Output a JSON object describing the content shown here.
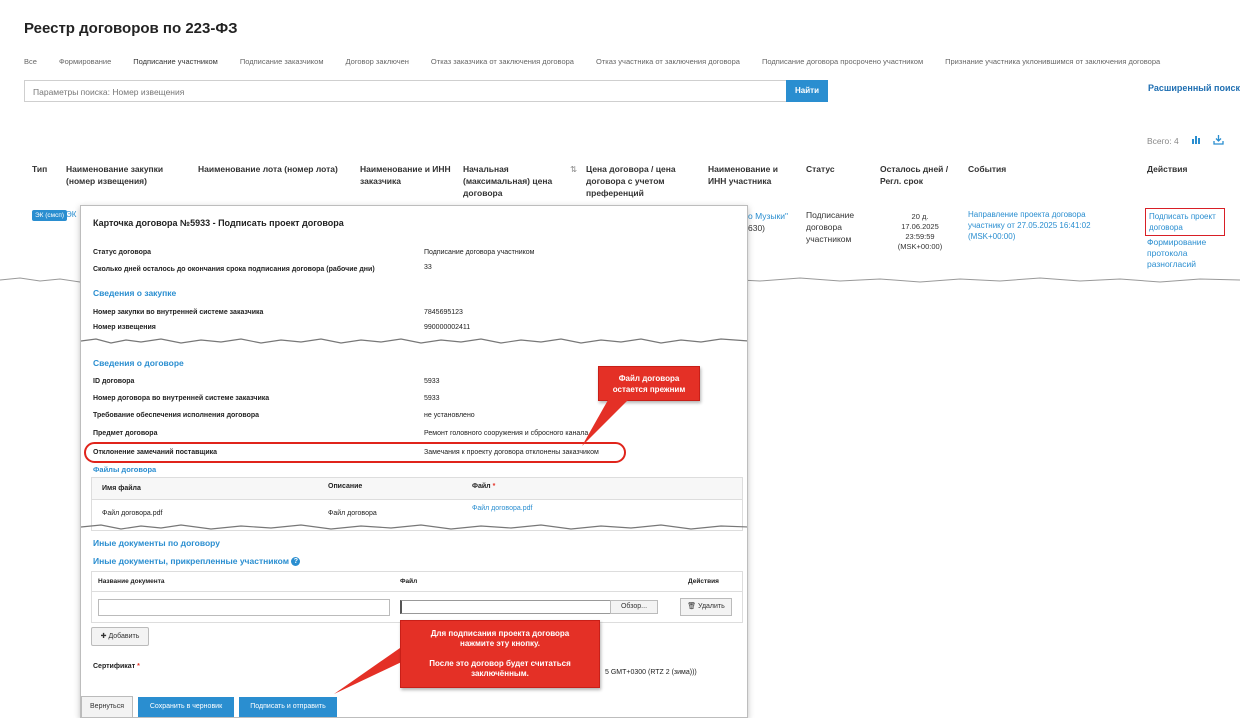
{
  "page": {
    "title": "Реестр договоров по 223-ФЗ"
  },
  "tabs": [
    "Все",
    "Формирование",
    "Подписание участником",
    "Подписание заказчиком",
    "Договор заключен",
    "Отказ заказчика от заключения договора",
    "Отказ участника от заключения договора",
    "Подписание договора просрочено участником",
    "Признание участника уклонившимся от заключения договора"
  ],
  "search": {
    "placeholder": "Параметры поиска: Номер извещения",
    "button": "Найти",
    "advanced": "Расширенный поиск"
  },
  "total": {
    "label": "Всего: 4"
  },
  "columns": {
    "type": "Тип",
    "purchase": "Наименование закупки (номер извещения)",
    "lot": "Наименование лота (номер лота)",
    "customer": "Наименование и ИНН заказчика",
    "start_price": "Начальная (максимальная) цена договора",
    "contract_price": "Цена договора / цена договора с учетом преференций",
    "participant": "Наименование и ИНН участника",
    "status": "Статус",
    "days_left": "Осталось дней / Регл. срок",
    "events": "События",
    "actions": "Действия"
  },
  "row": {
    "type_tag": "ЭК (смсп)",
    "purchase_frag": "ЭК",
    "participant_frag1": "о Музыки\"",
    "participant_frag2": "630)",
    "status_1": "Подписание",
    "status_2": "договора",
    "status_3": "участником",
    "days_1": "20 д.",
    "days_2": "17.06.2025",
    "days_3": "23:59:59",
    "days_4": "(MSK+00:00)",
    "event_1": "Направление проекта договора",
    "event_2": "участнику от 27.05.2025 16:41:02",
    "event_3": "(MSK+00:00)",
    "action_sign_1": "Подписать проект",
    "action_sign_2": "договора",
    "action_proto_1": "Формирование",
    "action_proto_2": "протокола",
    "action_proto_3": "разногласий"
  },
  "modal": {
    "title": "Карточка договора №5933 - Подписать проект договора",
    "contract_status_label": "Статус договора",
    "contract_status_value": "Подписание договора участником",
    "days_label": "Сколько дней осталось до окончания срока подписания договора (рабочие дни)",
    "days_value": "33",
    "purchase_section": "Сведения о закупке",
    "internal_num_label": "Номер закупки во внутренней системе заказчика",
    "internal_num_value": "7845695123",
    "notice_label": "Номер извещения",
    "notice_value": "990000002411",
    "contract_section": "Сведения о договоре",
    "id_label": "ID договора",
    "id_value": "5933",
    "cnum_label": "Номер договора во внутренней системе заказчика",
    "cnum_value": "5933",
    "security_label": "Требование обеспечения исполнения договора",
    "security_value": "не установлено",
    "subject_label": "Предмет договора",
    "subject_value": "Ремонт головного сооружения и сбросного канала",
    "rejection_label": "Отклонение замечаний поставщика",
    "rejection_value": "Замечания к проекту договора отклонены заказчиком",
    "files_section": "Файлы договора",
    "files_headers": [
      "Имя файла",
      "Описание",
      "Файл"
    ],
    "files_required_mark": "*",
    "file_name": "Файл договора.pdf",
    "file_desc": "Файл договора",
    "file_link": "Файл договора.pdf",
    "other_docs_section": "Иные документы по договору",
    "participant_docs_section": "Иные документы, прикрепленные участником",
    "docs_headers": [
      "Название документа",
      "Файл",
      "Действия"
    ],
    "browse_button": "Обзор...",
    "delete_button": "Удалить",
    "add_button": "Добавить",
    "cert_label": "Сертификат",
    "cert_required_mark": "*",
    "cert_value": "5 GMT+0300 (RTZ 2 (зима)))",
    "back_button": "Вернуться",
    "draft_button": "Сохранить в черновик",
    "sign_button": "Подписать и отправить"
  },
  "callouts": {
    "file_1": "Файл договора",
    "file_2": "остается прежним",
    "sign_1": "Для подписания проекта договора",
    "sign_2": "нажмите эту кнопку.",
    "sign_3": "После это договор будет считаться",
    "sign_4": "заключённым."
  },
  "colors": {
    "accent": "#2a8ed0",
    "callout": "#e43026",
    "highlight": "#d81f26"
  }
}
